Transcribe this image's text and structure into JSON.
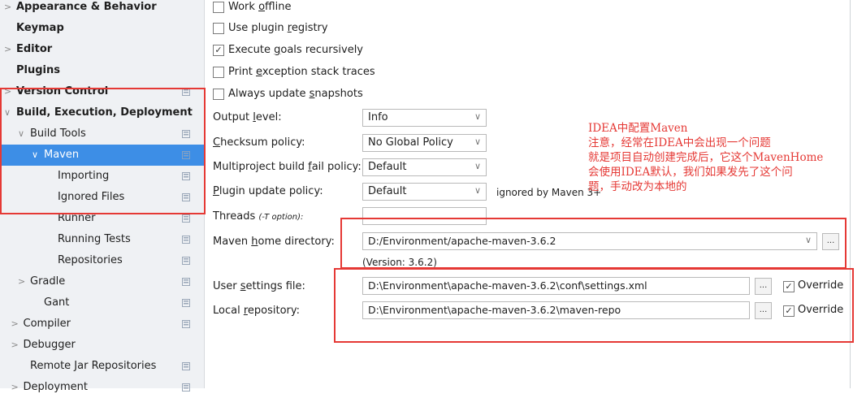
{
  "sidebar": {
    "items": [
      {
        "label": "Appearance & Behavior",
        "arrow": ">",
        "bold": true,
        "indent": 0,
        "icon": false,
        "selected": false
      },
      {
        "label": "Keymap",
        "arrow": "",
        "bold": true,
        "indent": 0,
        "icon": false,
        "selected": false
      },
      {
        "label": "Editor",
        "arrow": ">",
        "bold": true,
        "indent": 0,
        "icon": false,
        "selected": false
      },
      {
        "label": "Plugins",
        "arrow": "",
        "bold": true,
        "indent": 0,
        "icon": false,
        "selected": false
      },
      {
        "label": "Version Control",
        "arrow": ">",
        "bold": true,
        "indent": 0,
        "icon": true,
        "selected": false
      },
      {
        "label": "Build, Execution, Deployment",
        "arrow": "∨",
        "bold": true,
        "indent": 0,
        "icon": false,
        "selected": false
      },
      {
        "label": "Build Tools",
        "arrow": "∨",
        "bold": false,
        "indent": 1,
        "icon": true,
        "selected": false
      },
      {
        "label": "Maven",
        "arrow": "∨",
        "bold": false,
        "indent": 2,
        "icon": true,
        "selected": true
      },
      {
        "label": "Importing",
        "arrow": "",
        "bold": false,
        "indent": 3,
        "icon": true,
        "selected": false
      },
      {
        "label": "Ignored Files",
        "arrow": "",
        "bold": false,
        "indent": 3,
        "icon": true,
        "selected": false
      },
      {
        "label": "Runner",
        "arrow": "",
        "bold": false,
        "indent": 3,
        "icon": true,
        "selected": false
      },
      {
        "label": "Running Tests",
        "arrow": "",
        "bold": false,
        "indent": 3,
        "icon": true,
        "selected": false
      },
      {
        "label": "Repositories",
        "arrow": "",
        "bold": false,
        "indent": 3,
        "icon": true,
        "selected": false
      },
      {
        "label": "Gradle",
        "arrow": ">",
        "bold": false,
        "indent": 1,
        "icon": true,
        "selected": false
      },
      {
        "label": "Gant",
        "arrow": "",
        "bold": false,
        "indent": 2,
        "icon": true,
        "selected": false
      },
      {
        "label": "Compiler",
        "arrow": ">",
        "bold": false,
        "indent": 0.5,
        "icon": true,
        "selected": false
      },
      {
        "label": "Debugger",
        "arrow": ">",
        "bold": false,
        "indent": 0.5,
        "icon": false,
        "selected": false
      },
      {
        "label": "Remote Jar Repositories",
        "arrow": "",
        "bold": false,
        "indent": 1,
        "icon": true,
        "selected": false
      },
      {
        "label": "Deployment",
        "arrow": ">",
        "bold": false,
        "indent": 0.5,
        "icon": true,
        "selected": false
      }
    ]
  },
  "options": {
    "work_offline": {
      "pre": "Work ",
      "u": "o",
      "post": "ffline",
      "checked": false
    },
    "plugin_registry": {
      "pre": "Use plugin ",
      "u": "r",
      "post": "egistry",
      "checked": false
    },
    "execute_goals": {
      "pre": "Execute ",
      "u": "g",
      "post": "oals recursively",
      "checked": true
    },
    "print_traces": {
      "pre": "Print ",
      "u": "e",
      "post": "xception stack traces",
      "checked": false
    },
    "update_snapshots": {
      "pre": "Always update ",
      "u": "s",
      "post": "napshots",
      "checked": false
    }
  },
  "check_mark": "✓",
  "fields": {
    "output_level": {
      "pre": "Output ",
      "u": "l",
      "post": "evel:",
      "value": "Info"
    },
    "checksum_policy": {
      "pre": "",
      "u": "C",
      "post": "hecksum policy:",
      "value": "No Global Policy"
    },
    "multiproject_policy": {
      "pre": "Multiproject build ",
      "u": "f",
      "post": "ail policy:",
      "value": "Default"
    },
    "plugin_update_policy": {
      "pre": "",
      "u": "P",
      "post": "lugin update policy:",
      "value": "Default"
    },
    "plugin_update_note": "ignored by Maven 3+",
    "threads": {
      "label": "Threads",
      "hint": "(-T option):",
      "value": ""
    },
    "maven_home": {
      "pre": "Maven ",
      "u": "h",
      "post": "ome directory:",
      "value": "D:/Environment/apache-maven-3.6.2",
      "version": "(Version: 3.6.2)"
    },
    "user_settings": {
      "pre": "User ",
      "u": "s",
      "post": "ettings file:",
      "value": "D:\\Environment\\apache-maven-3.6.2\\conf\\settings.xml",
      "override": "Override",
      "override_checked": true
    },
    "local_repo": {
      "pre": "Local ",
      "u": "r",
      "post": "epository:",
      "value": "D:\\Environment\\apache-maven-3.6.2\\maven-repo",
      "override": "Override",
      "override_checked": true
    }
  },
  "browse_label": "...",
  "annotation": {
    "lines": [
      "IDEA中配置Maven",
      "注意，经常在IDEA中会出现一个问题",
      "就是项目自动创建完成后，它这个MavenHome",
      "会使用IDEA默认，我们如果发先了这个问",
      "题，手动改为本地的"
    ],
    "color": "#e53935"
  },
  "colors": {
    "selection": "#3d8ee6",
    "highlight": "#e53935",
    "sidebar_bg": "#eff1f4"
  }
}
